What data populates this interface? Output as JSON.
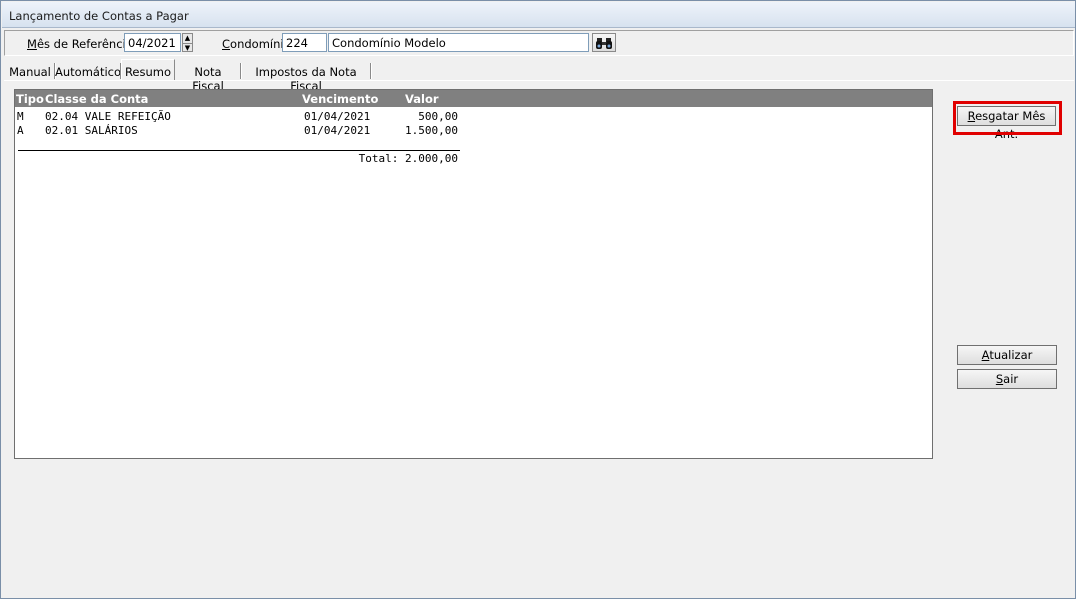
{
  "window": {
    "title": "Lançamento de Contas a Pagar"
  },
  "filters": {
    "mes_label_prefix": "M",
    "mes_label_rest": "ês de Referência:",
    "mes_value": "04/2021",
    "cond_label_prefix": "C",
    "cond_label_rest": "ondomínio:",
    "cond_code": "224",
    "cond_name": "Condomínio Modelo"
  },
  "tabs": [
    "Manual",
    "Automático",
    "Resumo",
    "Nota Fiscal",
    "Impostos da Nota Fiscal"
  ],
  "active_tab": "Resumo",
  "list": {
    "headers": {
      "tipo": "Tipo",
      "classe": "Classe da Conta",
      "vencimento": "Vencimento",
      "valor": "Valor"
    },
    "rows": [
      {
        "tipo": "M",
        "classe": "02.04 VALE REFEIÇÃO",
        "vencimento": "01/04/2021",
        "valor": "500,00"
      },
      {
        "tipo": "A",
        "classe": "02.01 SALÁRIOS",
        "vencimento": "01/04/2021",
        "valor": "1.500,00"
      }
    ],
    "total": "Total: 2.000,00"
  },
  "buttons": {
    "resgatar_prefix": "R",
    "resgatar_rest": "esgatar Mês Ant.",
    "atualizar_prefix": "A",
    "atualizar_rest": "tualizar",
    "sair_prefix": "S",
    "sair_rest": "air"
  },
  "colors": {
    "highlight": "#e00000",
    "list_header": "#808080"
  },
  "icons": {
    "spin": "spin-arrows-icon",
    "search": "binoculars-icon"
  }
}
